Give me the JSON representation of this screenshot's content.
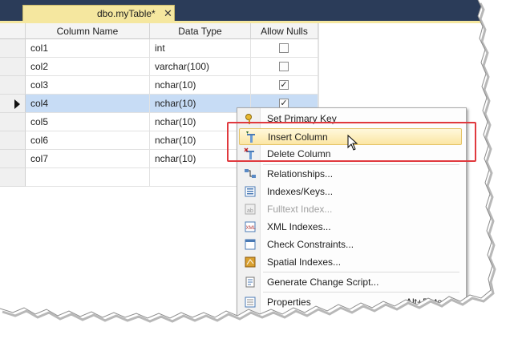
{
  "tab": {
    "title": "dbo.myTable*",
    "close_glyph": "✕"
  },
  "grid": {
    "columns": [
      "Column Name",
      "Data Type",
      "Allow Nulls"
    ],
    "rows": [
      {
        "name": "col1",
        "type": "int",
        "allow_nulls": false
      },
      {
        "name": "col2",
        "type": "varchar(100)",
        "allow_nulls": false
      },
      {
        "name": "col3",
        "type": "nchar(10)",
        "allow_nulls": true
      },
      {
        "name": "col4",
        "type": "nchar(10)",
        "allow_nulls": true,
        "current": true
      },
      {
        "name": "col5",
        "type": "nchar(10)",
        "allow_nulls": null
      },
      {
        "name": "col6",
        "type": "nchar(10)",
        "allow_nulls": null
      },
      {
        "name": "col7",
        "type": "nchar(10)",
        "allow_nulls": null
      },
      {
        "name": "",
        "type": "",
        "allow_nulls": null
      }
    ]
  },
  "menu": {
    "items": [
      {
        "label": "Set Primary Key",
        "icon": "key-icon"
      },
      {
        "label": "Insert Column",
        "icon": "insert-column-icon",
        "highlighted": true
      },
      {
        "label": "Delete Column",
        "icon": "delete-column-icon"
      },
      {
        "label": "Relationships...",
        "icon": "relationships-icon"
      },
      {
        "label": "Indexes/Keys...",
        "icon": "indexes-icon"
      },
      {
        "label": "Fulltext Index...",
        "icon": "fulltext-index-icon",
        "disabled": true
      },
      {
        "label": "XML Indexes...",
        "icon": "xml-indexes-icon"
      },
      {
        "label": "Check Constraints...",
        "icon": "check-constraints-icon"
      },
      {
        "label": "Spatial Indexes...",
        "icon": "spatial-indexes-icon"
      },
      {
        "label": "Generate Change Script...",
        "icon": "change-script-icon"
      },
      {
        "label": "Properties",
        "icon": "properties-icon",
        "shortcut": "Alt+Ente"
      }
    ]
  },
  "colors": {
    "tab_strip": "#2b3c59",
    "tab_active": "#f5e79f",
    "row_selected": "#c7dcf5",
    "menu_highlight": "#fbe6a4",
    "callout": "#e0393e"
  }
}
